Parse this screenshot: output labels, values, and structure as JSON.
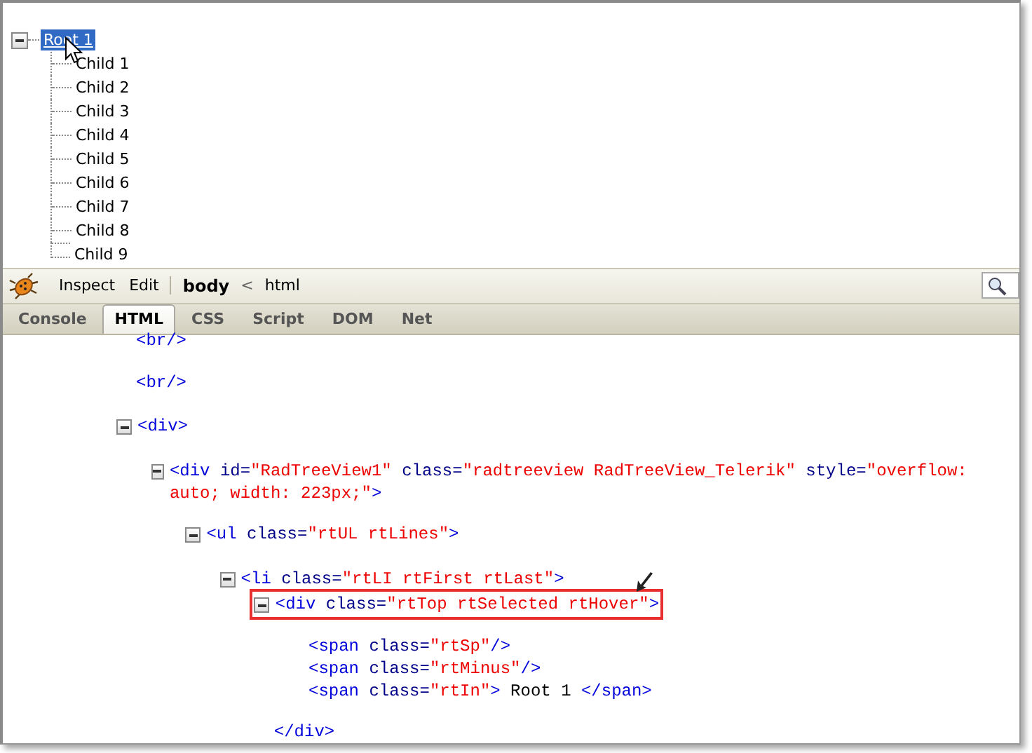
{
  "tree": {
    "root": {
      "label": "Root 1",
      "expanded": true,
      "selected": true,
      "hovered": true,
      "children": [
        {
          "label": "Child 1"
        },
        {
          "label": "Child 2"
        },
        {
          "label": "Child 3"
        },
        {
          "label": "Child 4"
        },
        {
          "label": "Child 5"
        },
        {
          "label": "Child 6"
        },
        {
          "label": "Child 7"
        },
        {
          "label": "Child 8"
        },
        {
          "label": "Child 9"
        }
      ]
    }
  },
  "toolbar": {
    "buttons": [
      "Inspect",
      "Edit"
    ],
    "breadcrumb": {
      "separator": "<",
      "items": [
        {
          "label": "body",
          "selected": true
        },
        {
          "label": "html",
          "selected": false
        }
      ]
    }
  },
  "tabs": [
    {
      "label": "Console",
      "selected": false
    },
    {
      "label": "HTML",
      "selected": true
    },
    {
      "label": "CSS",
      "selected": false
    },
    {
      "label": "Script",
      "selected": false
    },
    {
      "label": "DOM",
      "selected": false
    },
    {
      "label": "Net",
      "selected": false
    }
  ],
  "html_panel": {
    "nodes": [
      {
        "segments": [
          {
            "kind": "tag",
            "text": "<br/>"
          }
        ]
      },
      {
        "segments": [
          {
            "kind": "tag",
            "text": "<br/>"
          }
        ]
      },
      {
        "expanded": true,
        "segments": [
          {
            "kind": "tag",
            "text": "<div>"
          }
        ],
        "children": [
          {
            "expanded": true,
            "segments": [
              {
                "kind": "tag",
                "text": "<div"
              },
              {
                "kind": "attr",
                "text": " id="
              },
              {
                "kind": "value",
                "text": "\"RadTreeView1\""
              },
              {
                "kind": "attr",
                "text": " class="
              },
              {
                "kind": "value",
                "text": "\"radtreeview RadTreeView_Telerik\""
              },
              {
                "kind": "attr",
                "text": " style="
              },
              {
                "kind": "value",
                "text": "\"overflow: auto; width: 223px;\""
              },
              {
                "kind": "tag",
                "text": ">"
              }
            ],
            "children": [
              {
                "expanded": true,
                "segments": [
                  {
                    "kind": "tag",
                    "text": "<ul"
                  },
                  {
                    "kind": "attr",
                    "text": " class="
                  },
                  {
                    "kind": "value",
                    "text": "\"rtUL rtLines\""
                  },
                  {
                    "kind": "tag",
                    "text": ">"
                  }
                ],
                "children": [
                  {
                    "expanded": true,
                    "segments": [
                      {
                        "kind": "tag",
                        "text": "<li"
                      },
                      {
                        "kind": "attr",
                        "text": " class="
                      },
                      {
                        "kind": "value",
                        "text": "\"rtLI rtFirst rtLast\""
                      },
                      {
                        "kind": "tag",
                        "text": ">"
                      }
                    ],
                    "children": [
                      {
                        "expanded": true,
                        "highlighted": true,
                        "segments": [
                          {
                            "kind": "tag",
                            "text": "<div"
                          },
                          {
                            "kind": "attr",
                            "text": " class="
                          },
                          {
                            "kind": "value",
                            "text": "\"rtTop rtSelected rtHover\""
                          },
                          {
                            "kind": "tag",
                            "text": ">"
                          }
                        ],
                        "closing": [
                          {
                            "kind": "tag",
                            "text": "</div>"
                          }
                        ],
                        "children": [
                          {
                            "segments": [
                              {
                                "kind": "tag",
                                "text": "<span"
                              },
                              {
                                "kind": "attr",
                                "text": " class="
                              },
                              {
                                "kind": "value",
                                "text": "\"rtSp\""
                              },
                              {
                                "kind": "tag",
                                "text": "/>"
                              }
                            ]
                          },
                          {
                            "segments": [
                              {
                                "kind": "tag",
                                "text": "<span"
                              },
                              {
                                "kind": "attr",
                                "text": " class="
                              },
                              {
                                "kind": "value",
                                "text": "\"rtMinus\""
                              },
                              {
                                "kind": "tag",
                                "text": "/>"
                              }
                            ]
                          },
                          {
                            "segments": [
                              {
                                "kind": "tag",
                                "text": "<span"
                              },
                              {
                                "kind": "attr",
                                "text": " class="
                              },
                              {
                                "kind": "value",
                                "text": "\"rtIn\""
                              },
                              {
                                "kind": "tag",
                                "text": ">"
                              },
                              {
                                "kind": "text",
                                "text": " Root 1 "
                              },
                              {
                                "kind": "tag",
                                "text": "</span>"
                              }
                            ]
                          }
                        ]
                      }
                    ]
                  }
                ]
              }
            ]
          }
        ]
      }
    ]
  }
}
